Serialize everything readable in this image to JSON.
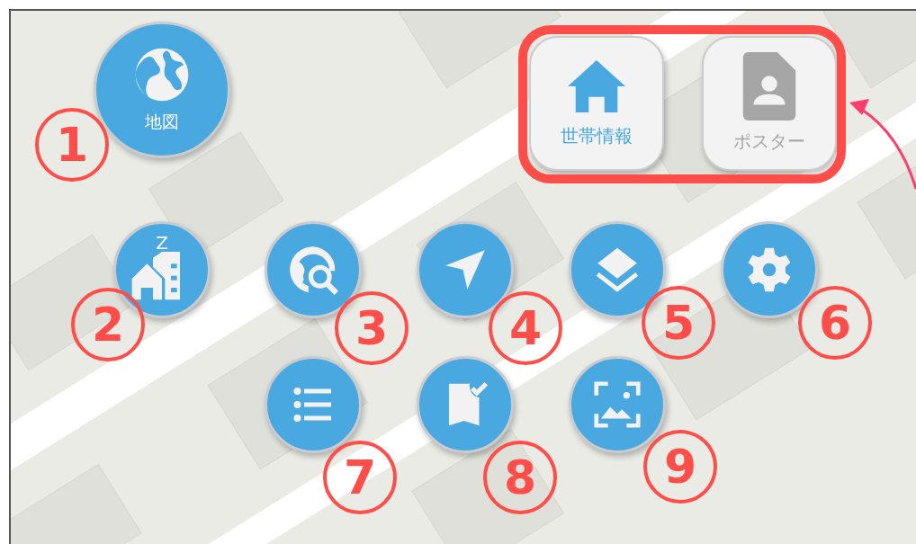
{
  "map_button": {
    "label": "地図"
  },
  "top_buttons": [
    {
      "label": "世帯情報",
      "selected": true
    },
    {
      "label": "ポスター",
      "selected": false
    }
  ],
  "tool_buttons": [
    {
      "kind": "sleep-building",
      "badge": "Z"
    },
    {
      "kind": "globe-search"
    },
    {
      "kind": "navigate"
    },
    {
      "kind": "layers"
    },
    {
      "kind": "settings"
    },
    {
      "kind": "list"
    },
    {
      "kind": "bookmark-check"
    },
    {
      "kind": "image-frame"
    }
  ],
  "annotations": [
    {
      "number": "1"
    },
    {
      "number": "2"
    },
    {
      "number": "3"
    },
    {
      "number": "4"
    },
    {
      "number": "5"
    },
    {
      "number": "6"
    },
    {
      "number": "7"
    },
    {
      "number": "8"
    },
    {
      "number": "9"
    }
  ]
}
